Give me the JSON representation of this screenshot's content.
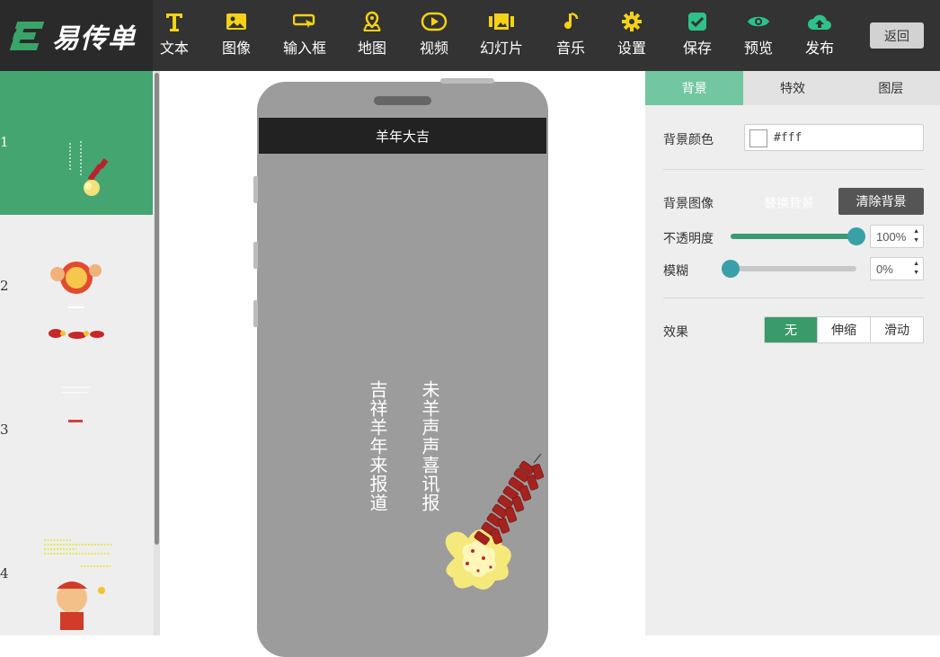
{
  "brand": {
    "name": "易传单",
    "accent": "#45a570"
  },
  "toolbar": {
    "items": [
      {
        "label": "文本",
        "icon": "text-icon"
      },
      {
        "label": "图像",
        "icon": "image-icon"
      },
      {
        "label": "输入框",
        "icon": "input-box-icon"
      },
      {
        "label": "地图",
        "icon": "map-pin-icon"
      },
      {
        "label": "视频",
        "icon": "video-play-icon"
      },
      {
        "label": "幻灯片",
        "icon": "slideshow-icon"
      },
      {
        "label": "音乐",
        "icon": "music-note-icon"
      },
      {
        "label": "设置",
        "icon": "gear-icon"
      },
      {
        "label": "保存",
        "icon": "save-check-icon"
      },
      {
        "label": "预览",
        "icon": "eye-icon"
      },
      {
        "label": "发布",
        "icon": "cloud-upload-icon"
      }
    ],
    "back_label": "返回"
  },
  "slides": [
    {
      "number": "1",
      "active": true
    },
    {
      "number": "2",
      "active": false
    },
    {
      "number": "3",
      "active": false
    },
    {
      "number": "4",
      "active": false
    }
  ],
  "phone": {
    "header_title": "羊年大吉",
    "vertical_line_1": "未羊声声喜讯报",
    "vertical_line_2": "吉祥羊年来报道"
  },
  "panel": {
    "tabs": [
      {
        "label": "背景",
        "active": true
      },
      {
        "label": "特效",
        "active": false
      },
      {
        "label": "图层",
        "active": false
      }
    ],
    "bg_color_label": "背景颜色",
    "bg_color_value": "#fff",
    "bg_image_label": "背景图像",
    "replace_bg_label": "替换背景",
    "clear_bg_label": "清除背景",
    "opacity_label": "不透明度",
    "opacity_value": "100%",
    "blur_label": "模糊",
    "blur_value": "0%",
    "effect_label": "效果",
    "effect_options": [
      {
        "label": "无",
        "active": true
      },
      {
        "label": "伸缩",
        "active": false
      },
      {
        "label": "滑动",
        "active": false
      }
    ]
  },
  "colors": {
    "icon_yellow": "#f5d118",
    "icon_green": "#2ec28a",
    "panel_green": "#72c6a0"
  }
}
